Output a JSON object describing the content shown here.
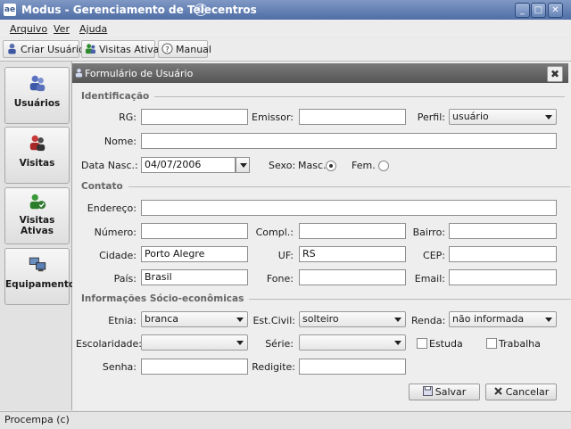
{
  "window": {
    "title": "Modus - Gerenciamento de Telecentros",
    "app_icon_text": "ae",
    "title_icon_text": "☺",
    "controls": {
      "minimize": "_",
      "maximize": "□",
      "close": "✕"
    }
  },
  "menubar": {
    "items": [
      "Arquivo",
      "Ver",
      "Ajuda"
    ]
  },
  "toolbar": {
    "criar_usuario": "Criar Usuário",
    "visitas_ativas": "Visitas Ativas",
    "manual": "Manual"
  },
  "sidebar": {
    "usuarios": "Usuários",
    "visitas": "Visitas",
    "visitas_ativas_line1": "Visitas",
    "visitas_ativas_line2": "Ativas",
    "equipamentos": "Equipamentos"
  },
  "form": {
    "title": "Formulário de Usuário",
    "close_symbol": "✖",
    "sections": {
      "identificacao": "Identificação",
      "contato": "Contato",
      "socio": "Informações Sócio-econômicas"
    },
    "labels": {
      "rg": "RG:",
      "emissor": "Emissor:",
      "perfil": "Perfil:",
      "nome": "Nome:",
      "data_nasc": "Data Nasc.:",
      "sexo": "Sexo:",
      "masc": "Masc.",
      "fem": "Fem.",
      "endereco": "Endereço:",
      "numero": "Número:",
      "compl": "Compl.:",
      "bairro": "Bairro:",
      "cidade": "Cidade:",
      "uf": "UF:",
      "cep": "CEP:",
      "pais": "País:",
      "fone": "Fone:",
      "email": "Email:",
      "etnia": "Etnia:",
      "est_civil": "Est.Civil:",
      "renda": "Renda:",
      "escolaridade": "Escolaridade:",
      "serie": "Série:",
      "estuda": "Estuda",
      "trabalha": "Trabalha",
      "senha": "Senha:",
      "redigite": "Redigite:"
    },
    "values": {
      "rg": "",
      "emissor": "",
      "perfil": "usuário",
      "nome": "",
      "data_nasc": "04/07/2006",
      "sexo": "Masc.",
      "endereco": "",
      "numero": "",
      "compl": "",
      "bairro": "",
      "cidade": "Porto Alegre",
      "uf": "RS",
      "cep": "",
      "pais": "Brasil",
      "fone": "",
      "email": "",
      "etnia": "branca",
      "est_civil": "solteiro",
      "renda": "não informada",
      "escolaridade": "",
      "serie": "",
      "estuda": false,
      "trabalha": false,
      "senha": "",
      "redigite": ""
    },
    "buttons": {
      "salvar": "Salvar",
      "cancelar": "Cancelar"
    }
  },
  "status": {
    "text": "Procempa (c)"
  }
}
